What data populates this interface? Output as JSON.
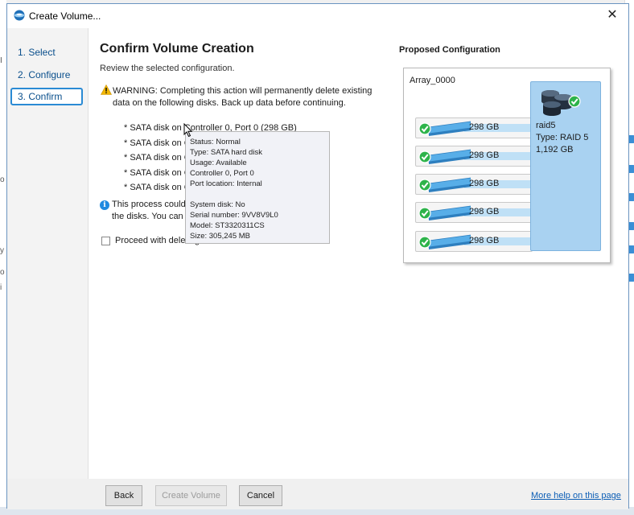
{
  "window": {
    "title": "Create Volume...",
    "close_glyph": "✕"
  },
  "steps": [
    {
      "label": "1. Select"
    },
    {
      "label": "2. Configure"
    },
    {
      "label": "3. Confirm"
    }
  ],
  "main": {
    "heading": "Confirm Volume Creation",
    "subtitle": "Review the selected configuration.",
    "warning_line1": "WARNING: Completing this action will permanently delete existing",
    "warning_line2": "data on the following disks. Back up data before continuing.",
    "disks": [
      "* SATA disk on Controller 0, Port 0 (298 GB)",
      "* SATA disk on C",
      "* SATA disk on C",
      "* SATA disk on C",
      "* SATA disk on C"
    ],
    "info_line1": "This process could                                    er and size of",
    "info_line2": "the disks. You can c                                  ng this time.",
    "proceed_label": "Proceed with deleting data"
  },
  "tooltip": {
    "status": "Status: Normal",
    "type": "Type: SATA hard disk",
    "usage": "Usage: Available",
    "controller": "Controller 0, Port 0",
    "port_location": "Port location: Internal",
    "system_disk": "System disk: No",
    "serial": "Serial number: 9VV8V9L0",
    "model": "Model: ST3320311CS",
    "size": "Size: 305,245 MB"
  },
  "proposed": {
    "title": "Proposed Configuration",
    "array_label": "Array_0000",
    "raid_name": "raid5",
    "raid_type": "Type: RAID 5",
    "raid_size": "1,192 GB",
    "disk_sizes": [
      "298 GB",
      "298 GB",
      "298 GB",
      "298 GB",
      "298 GB"
    ]
  },
  "footer": {
    "back": "Back",
    "create": "Create Volume",
    "cancel": "Cancel",
    "help": "More help on this page"
  },
  "colors": {
    "accent": "#2a8ad4",
    "link": "#0b5db5",
    "raid_fill": "#a9d2f1",
    "check": "#2db34a"
  }
}
